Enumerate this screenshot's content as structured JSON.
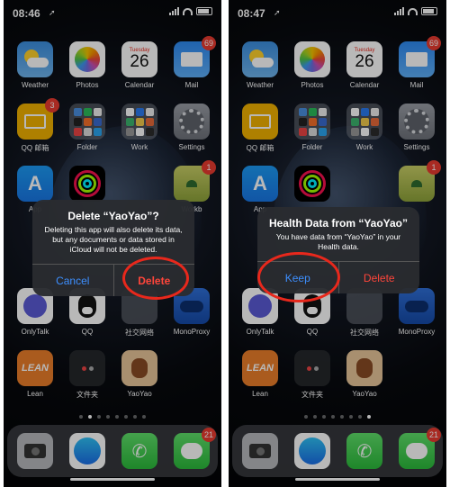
{
  "colors": {
    "accent_red": "#e8281c",
    "alert_blue": "#3d8fff",
    "destructive": "#ff453a"
  },
  "left": {
    "status": {
      "time": "08:46",
      "location_arrow": "➚"
    },
    "alert": {
      "title": "Delete “YaoYao”?",
      "message": "Deleting this app will also delete its data, but any documents or data stored in iCloud will not be deleted.",
      "cancel": "Cancel",
      "delete": "Delete"
    }
  },
  "right": {
    "status": {
      "time": "08:47",
      "location_arrow": "➚"
    },
    "alert": {
      "title": "Health Data from “YaoYao”",
      "message": "You have data from “YaoYao” in your Health data.",
      "keep": "Keep",
      "delete": "Delete"
    }
  },
  "apps": {
    "weather": "Weather",
    "photos": "Photos",
    "calendar": "Calendar",
    "calendar_day": "Tuesday",
    "calendar_date": "26",
    "mail": "Mail",
    "mail_badge": "69",
    "qqmail": "QQ 邮箱",
    "qqmail_badge": "3",
    "folder": "Folder",
    "work": "Work",
    "settings": "Settings",
    "appstore": "App",
    "workbench": "Workb",
    "workbench_badge": "1",
    "onlytalk": "OnlyTalk",
    "qq": "QQ",
    "social": "社交网络",
    "monoproxy": "MonoProxy",
    "lean": "Lean",
    "lean_logo": "LEAN",
    "wenjianjia": "文件夹",
    "yaoyao": "YaoYao",
    "messages_badge": "21"
  }
}
